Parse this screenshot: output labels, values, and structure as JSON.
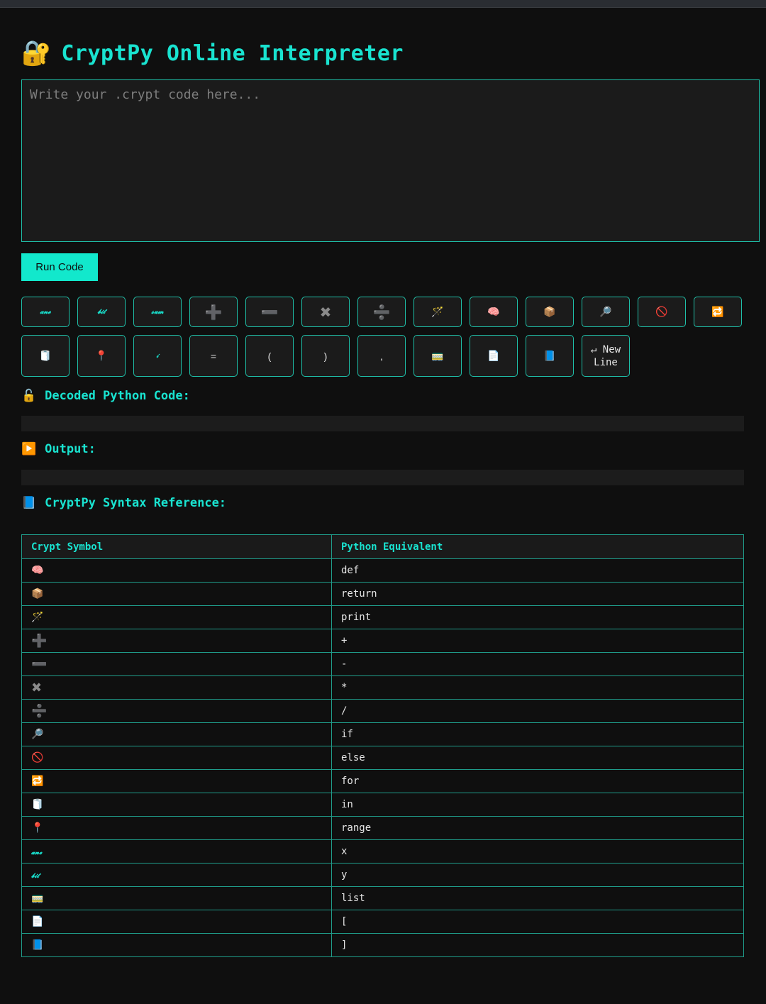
{
  "app": {
    "title": "CryptPy Online Interpreter",
    "title_icon": "🔐"
  },
  "editor": {
    "placeholder": "Write your .crypt code here...",
    "value": ""
  },
  "run_button": {
    "label": "Run Code"
  },
  "keyboard": {
    "row1": [
      {
        "sym": "𝓪𝓷𝓮",
        "style": "script",
        "name": "key-ane"
      },
      {
        "sym": "𝓫𝓲𝓽",
        "style": "script",
        "name": "key-bit"
      },
      {
        "sym": "𝓼𝓾𝓶",
        "style": "script",
        "name": "key-sum"
      },
      {
        "sym": "➕",
        "style": "math",
        "name": "key-plus"
      },
      {
        "sym": "➖",
        "style": "math",
        "name": "key-minus"
      },
      {
        "sym": "✖",
        "style": "math",
        "name": "key-multiply"
      },
      {
        "sym": "➗",
        "style": "math",
        "name": "key-divide"
      },
      {
        "sym": "🪄",
        "style": "emoji",
        "name": "key-magic-wand"
      },
      {
        "sym": "🧠",
        "style": "emoji",
        "name": "key-brain"
      },
      {
        "sym": "📦",
        "style": "emoji",
        "name": "key-package"
      },
      {
        "sym": "🔎",
        "style": "emoji",
        "name": "key-magnifier"
      },
      {
        "sym": "🚫",
        "style": "emoji",
        "name": "key-prohibited"
      },
      {
        "sym": "🔁",
        "style": "emoji",
        "name": "key-repeat"
      }
    ],
    "row2": [
      {
        "sym": "🧻",
        "style": "emoji",
        "name": "key-paper-roll"
      },
      {
        "sym": "📍",
        "style": "emoji",
        "name": "key-pin"
      },
      {
        "sym": "𝒾",
        "style": "script",
        "name": "key-i"
      },
      {
        "sym": "=",
        "style": "plain",
        "name": "key-equals"
      },
      {
        "sym": "(",
        "style": "plain",
        "name": "key-open-paren"
      },
      {
        "sym": ")",
        "style": "plain",
        "name": "key-close-paren"
      },
      {
        "sym": ",",
        "style": "plain",
        "name": "key-comma"
      },
      {
        "sym": "🚃",
        "style": "emoji",
        "name": "key-train-car"
      },
      {
        "sym": "📄",
        "style": "emoji",
        "name": "key-page"
      },
      {
        "sym": "📘",
        "style": "emoji",
        "name": "key-blue-book"
      },
      {
        "sym": "↵ New\nLine",
        "style": "newline",
        "name": "key-new-line"
      }
    ]
  },
  "sections": {
    "decoded": {
      "icon": "🔓",
      "label": "Decoded Python Code:",
      "content": ""
    },
    "output": {
      "icon": "▶️",
      "label": "Output:",
      "content": ""
    },
    "reference": {
      "icon": "📘",
      "label": "CryptPy Syntax Reference:"
    }
  },
  "reference_table": {
    "headers": [
      "Crypt Symbol",
      "Python Equivalent"
    ],
    "rows": [
      {
        "sym": "🧠",
        "style": "emoji",
        "py": "def"
      },
      {
        "sym": "📦",
        "style": "emoji",
        "py": "return"
      },
      {
        "sym": "🪄",
        "style": "emoji",
        "py": "print"
      },
      {
        "sym": "➕",
        "style": "math",
        "py": "+"
      },
      {
        "sym": "➖",
        "style": "math",
        "py": "-"
      },
      {
        "sym": "✖",
        "style": "math",
        "py": "*"
      },
      {
        "sym": "➗",
        "style": "math",
        "py": "/"
      },
      {
        "sym": "🔎",
        "style": "emoji",
        "py": "if"
      },
      {
        "sym": "🚫",
        "style": "emoji",
        "py": "else"
      },
      {
        "sym": "🔁",
        "style": "emoji",
        "py": "for"
      },
      {
        "sym": "🧻",
        "style": "emoji",
        "py": "in"
      },
      {
        "sym": "📍",
        "style": "emoji",
        "py": "range"
      },
      {
        "sym": "𝓪𝓷𝓮",
        "style": "script",
        "py": "x"
      },
      {
        "sym": "𝓫𝓲𝓽",
        "style": "script",
        "py": "y"
      },
      {
        "sym": "🚃",
        "style": "emoji",
        "py": "list"
      },
      {
        "sym": "📄",
        "style": "emoji",
        "py": "["
      },
      {
        "sym": "📘",
        "style": "emoji",
        "py": "]"
      }
    ]
  },
  "colors": {
    "accent": "#19e3d0",
    "button": "#12e8cc",
    "border": "#1fbfa8",
    "background": "#0f0f0f",
    "panel": "#1b1b1b"
  }
}
